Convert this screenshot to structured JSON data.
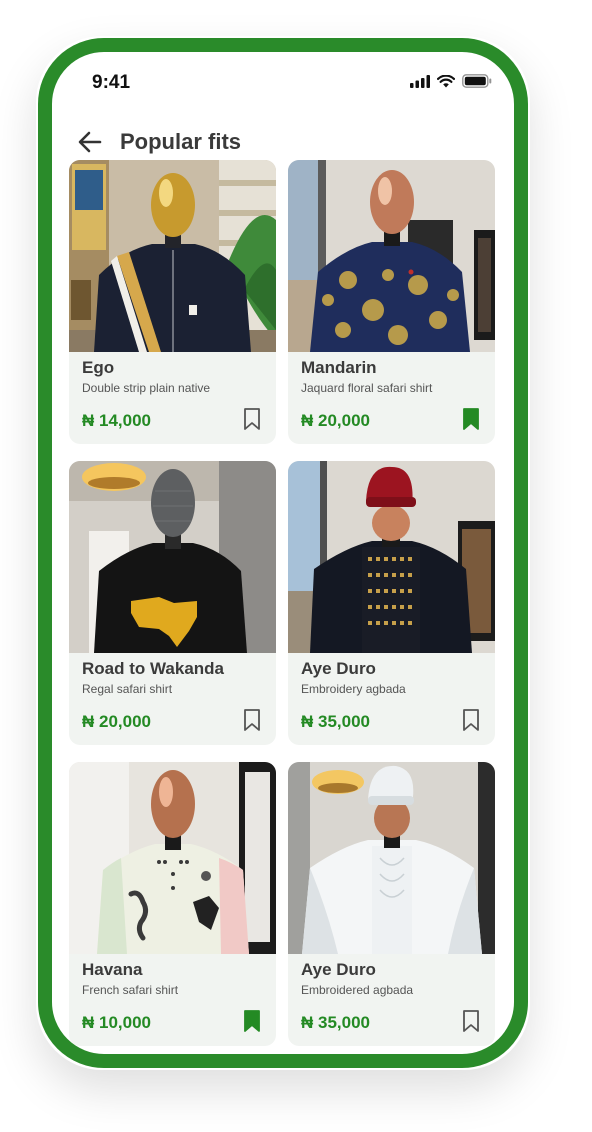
{
  "status_bar": {
    "time": "9:41",
    "icons": [
      "signal-icon",
      "wifi-icon",
      "battery-icon"
    ]
  },
  "header": {
    "title": "Popular fits",
    "back_icon": "arrow-left-icon"
  },
  "colors": {
    "brand_green": "#2a8b2a",
    "price_green": "#248a24",
    "card_bg": "#f1f4f1"
  },
  "products": [
    {
      "name": "Ego",
      "description": "Double strip plain native",
      "price": "₦ 14,000",
      "saved": false
    },
    {
      "name": "Mandarin",
      "description": "Jaquard floral safari shirt",
      "price": "₦ 20,000",
      "saved": true
    },
    {
      "name": "Road to Wakanda",
      "description": "Regal safari shirt",
      "price": "₦ 20,000",
      "saved": false
    },
    {
      "name": "Aye Duro",
      "description": "Embroidery agbada",
      "price": "₦ 35,000",
      "saved": false
    },
    {
      "name": "Havana",
      "description": "French safari shirt",
      "price": "₦ 10,000",
      "saved": true
    },
    {
      "name": "Aye Duro",
      "description": "Embroidered agbada",
      "price": "₦ 35,000",
      "saved": false
    }
  ]
}
